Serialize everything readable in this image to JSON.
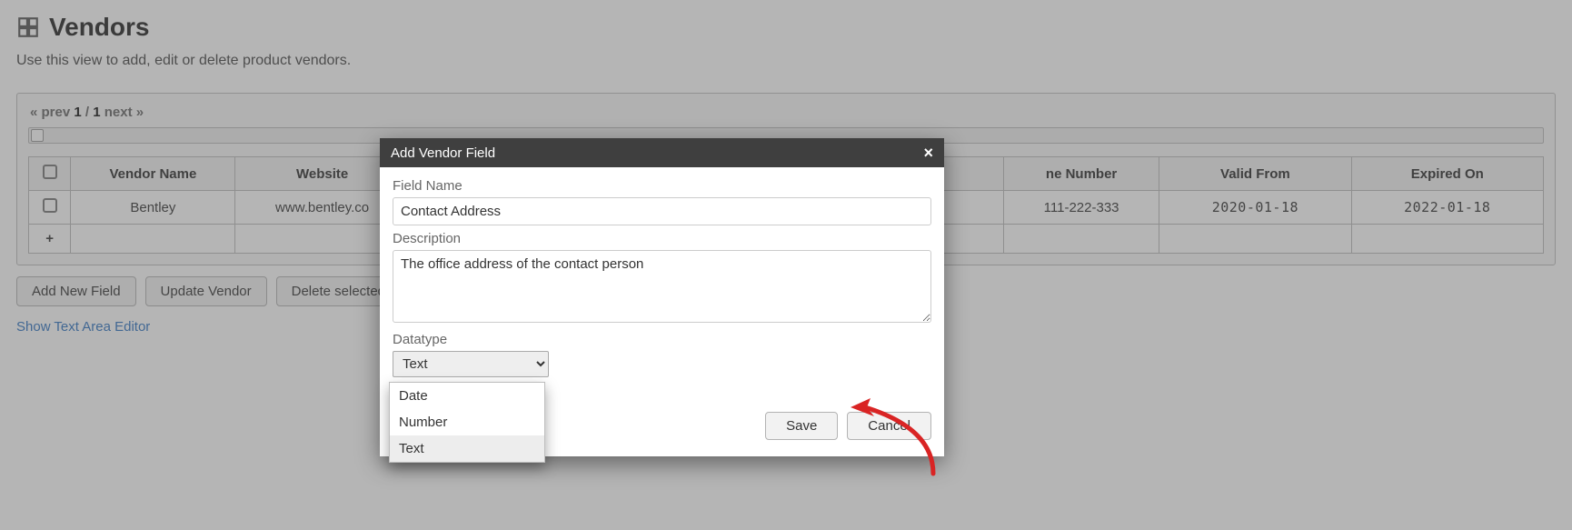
{
  "page": {
    "title": "Vendors",
    "subtitle": "Use this view to add, edit or delete product vendors."
  },
  "pager": {
    "prev": "« prev",
    "current": "1",
    "sep": "/",
    "total": "1",
    "next": "next »"
  },
  "table": {
    "headers": {
      "name": "Vendor Name",
      "website": "Website",
      "phone": "ne Number",
      "valid_from": "Valid From",
      "expired_on": "Expired On"
    },
    "rows": [
      {
        "name": "Bentley",
        "website": "www.bentley.co",
        "phone": "111-222-333",
        "valid_from": "2020-01-18",
        "expired_on": "2022-01-18"
      }
    ]
  },
  "buttons": {
    "add_field": "Add New Field",
    "update_vendor": "Update Vendor",
    "delete_selected": "Delete selected",
    "show_editor": "Show Text Area Editor"
  },
  "modal": {
    "title": "Add Vendor Field",
    "labels": {
      "field_name": "Field Name",
      "description": "Description",
      "datatype": "Datatype"
    },
    "values": {
      "field_name": "Contact Address",
      "description": "The office address of the contact person",
      "datatype_selected": "Text"
    },
    "datatype_options": [
      "Date",
      "Number",
      "Text"
    ],
    "actions": {
      "save": "Save",
      "cancel": "Cancel"
    }
  }
}
